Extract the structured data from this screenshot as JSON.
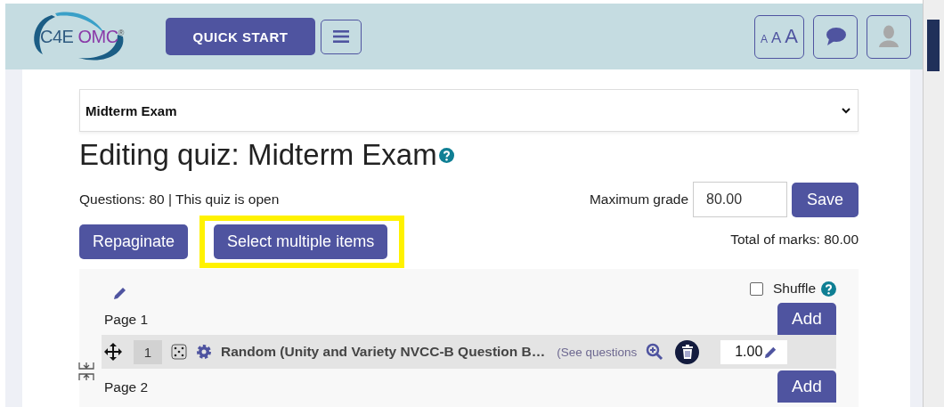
{
  "header": {
    "logo_text": "C4E",
    "logo_accent": "OMC",
    "logo_mark": "®",
    "quick_start": "QUICK START",
    "font_sizes": [
      "A",
      "A",
      "A"
    ]
  },
  "course_select": {
    "value": "Midterm Exam"
  },
  "title": "Editing quiz: Midterm Exam",
  "summary": "Questions: 80 | This quiz is open",
  "max_grade": {
    "label": "Maximum grade",
    "value": "80.00",
    "button": "Save"
  },
  "buttons": [
    {
      "label": "Repaginate",
      "highlighted": false
    },
    {
      "label": "Select multiple items",
      "highlighted": true
    }
  ],
  "total_marks": "Total of marks: 80.00",
  "section": {
    "shuffle": {
      "label": "Shuffle",
      "checked": false
    },
    "pages": [
      {
        "label": "Page 1",
        "add": "Add",
        "questions": [
          {
            "number": "1",
            "title": "Random (Unity and Variety NVCC-B Question B…",
            "preview": "(See questions",
            "mark": "1.00"
          }
        ]
      },
      {
        "label": "Page 2",
        "add": "Add"
      }
    ]
  }
}
